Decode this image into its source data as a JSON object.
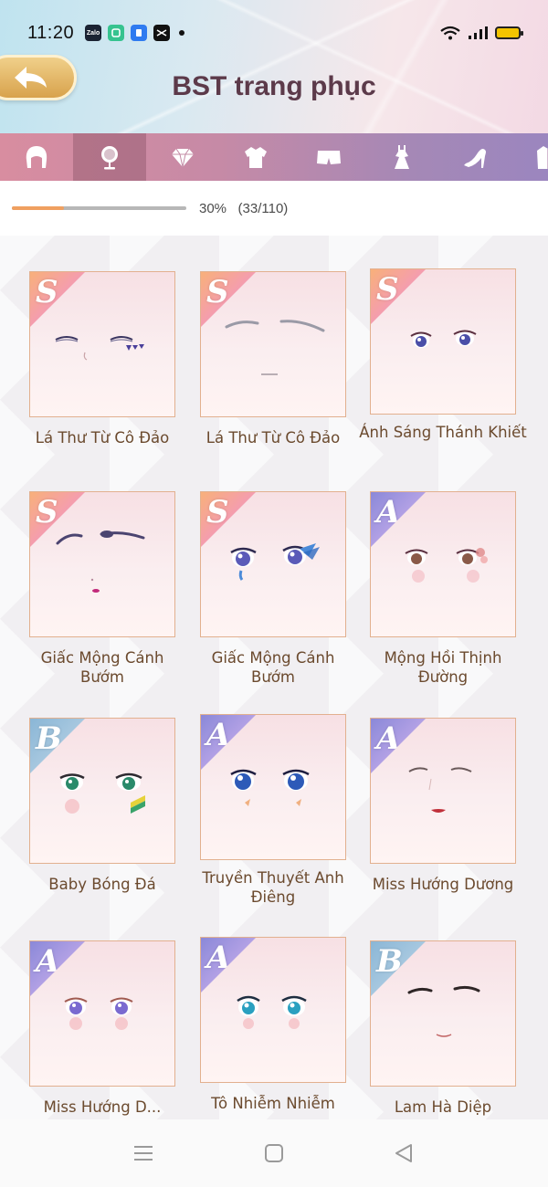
{
  "status_bar": {
    "time": "11:20",
    "apps": [
      {
        "icon": "zalo-icon",
        "label": "Zalo",
        "color": "#1b2333"
      },
      {
        "icon": "app-green-icon",
        "label": "",
        "color": "#36c38f"
      },
      {
        "icon": "app-blue-icon",
        "label": "",
        "color": "#2f7bf0"
      },
      {
        "icon": "capcut-icon",
        "label": "",
        "color": "#111111"
      }
    ]
  },
  "header": {
    "title": "BST trang phục",
    "back_icon": "back-arrow-icon"
  },
  "tabs": [
    {
      "name": "hair",
      "icon": "hair-icon",
      "active": false
    },
    {
      "name": "makeup",
      "icon": "mirror-icon",
      "active": true
    },
    {
      "name": "accessory",
      "icon": "diamond-icon",
      "active": false
    },
    {
      "name": "top",
      "icon": "jacket-icon",
      "active": false
    },
    {
      "name": "bottom",
      "icon": "shorts-icon",
      "active": false
    },
    {
      "name": "dress",
      "icon": "dress-icon",
      "active": false
    },
    {
      "name": "shoes",
      "icon": "high-heel-icon",
      "active": false
    },
    {
      "name": "coat",
      "icon": "coat-icon",
      "active": false
    }
  ],
  "progress": {
    "percent_text": "30%",
    "count_text": "(33/110)",
    "fraction": 0.3,
    "fill_color": "#f0a060"
  },
  "items": [
    {
      "rank": "S",
      "name": "Lá Thư Từ Cô Đảo",
      "face": "closed"
    },
    {
      "rank": "S",
      "name": "Lá Thư Từ Cô Đảo",
      "face": "brows"
    },
    {
      "rank": "S",
      "name": "Ánh Sáng Thánh Khiết",
      "face": "small-eyes"
    },
    {
      "rank": "S",
      "name": "Giấc Mộng Cánh Bướm",
      "face": "brows-dark"
    },
    {
      "rank": "S",
      "name": "Giấc Mộng Cánh Bướm",
      "face": "butterfly"
    },
    {
      "rank": "A",
      "name": "Mộng Hồi Thịnh Đường",
      "face": "floral"
    },
    {
      "rank": "B",
      "name": "Baby Bóng Đá",
      "face": "green"
    },
    {
      "rank": "A",
      "name": "Truyền Thuyết Anh Điêng",
      "face": "blue"
    },
    {
      "rank": "A",
      "name": "Miss Hướng Dương",
      "face": "lips"
    },
    {
      "rank": "A",
      "name": "Miss Hướng D...",
      "face": "violet"
    },
    {
      "rank": "A",
      "name": "Tô Nhiễm Nhiễm",
      "face": "teal"
    },
    {
      "rank": "B",
      "name": "Lam Hà Diệp",
      "face": "smile"
    }
  ],
  "nav": {
    "menu_icon": "menu-icon",
    "home_icon": "home-square-icon",
    "back_icon": "back-triangle-icon"
  }
}
